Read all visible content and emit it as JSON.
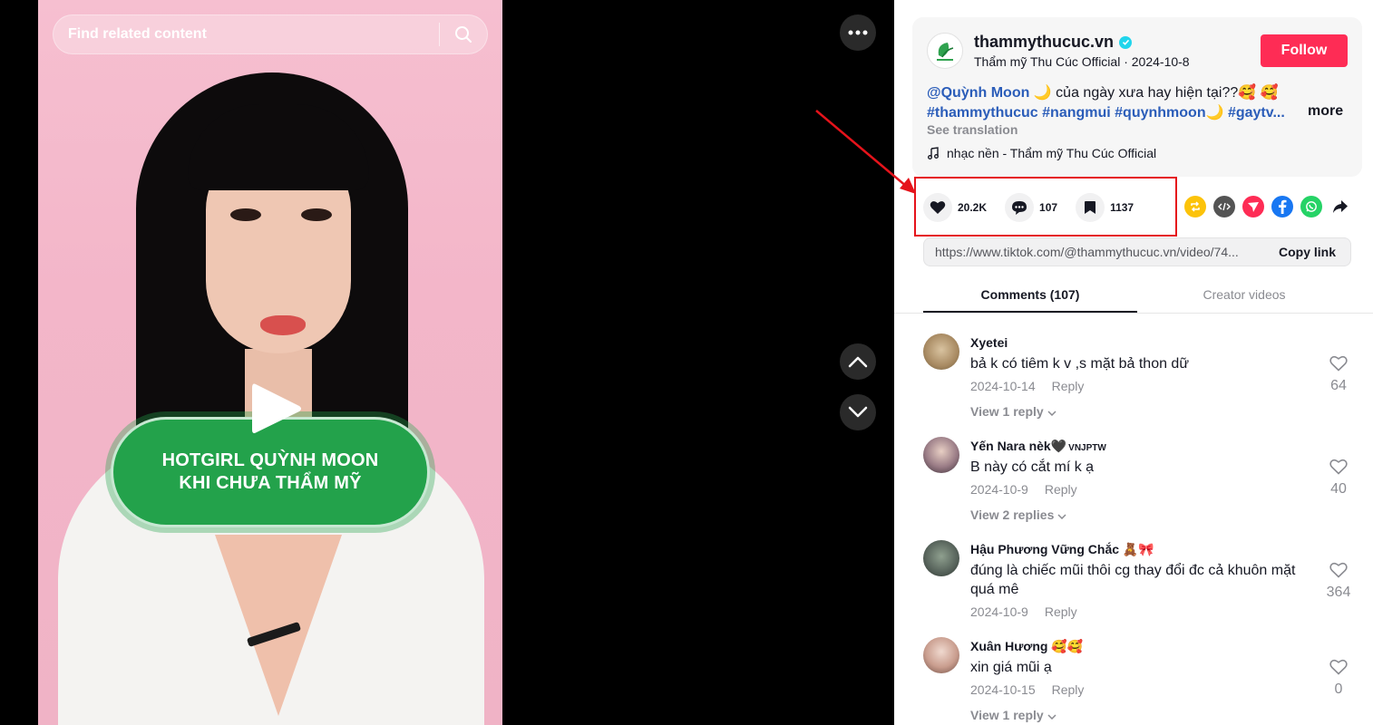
{
  "video": {
    "search_placeholder": "Find related content",
    "promo_line1": "HOTGIRL QUỲNH MOON",
    "promo_line2": "KHI CHƯA THẨM MỸ"
  },
  "post": {
    "username": "thammythucuc.vn",
    "display_name": "Thẩm mỹ Thu Cúc Official",
    "date": "2024-10-8",
    "follow_label": "Follow",
    "caption_mention": "@Quỳnh Moon",
    "caption_text1": " 🌙 của ngày xưa hay hiện tại??🥰 🥰",
    "caption_tags": "#thammythucuc #nangmui #quynhmoon🌙 #gaytv...",
    "more_label": "more",
    "see_translation": "See translation",
    "music": "nhạc nền - Thẩm mỹ Thu Cúc Official"
  },
  "stats": {
    "likes": "20.2K",
    "comments": "107",
    "saves": "1137"
  },
  "share": {
    "url": "https://www.tiktok.com/@thammythucuc.vn/video/74...",
    "copy_label": "Copy link",
    "icons": [
      "repost-icon",
      "embed-icon",
      "send-icon",
      "facebook-icon",
      "whatsapp-icon",
      "share-arrow-icon"
    ]
  },
  "tabs": [
    {
      "label": "Comments (107)"
    },
    {
      "label": "Creator videos"
    }
  ],
  "comments": [
    {
      "name": "Xyetei",
      "badge": "",
      "text": "bả k có tiêm k v ,s mặt bả thon dữ",
      "date": "2024-10-14",
      "reply": "Reply",
      "likes": "64",
      "view": "View 1 reply",
      "avatar_color": "#b99d74"
    },
    {
      "name": "Yến Nara nèk🖤",
      "badge": "VNJPTW",
      "text": "B này có cắt mí k ạ",
      "date": "2024-10-9",
      "reply": "Reply",
      "likes": "40",
      "view": "View 2 replies",
      "avatar_color": "#6b5a66"
    },
    {
      "name": "Hậu Phương Vững Chắc 🧸🎀",
      "badge": "",
      "text": "đúng là chiếc mũi thôi cg thay đổi đc cả khuôn mặt quá mê",
      "date": "2024-10-9",
      "reply": "Reply",
      "likes": "364",
      "view": "",
      "avatar_color": "#55625a"
    },
    {
      "name": "Xuân Hương 🥰🥰",
      "badge": "",
      "text": "xin giá mũi ạ",
      "date": "2024-10-15",
      "reply": "Reply",
      "likes": "0",
      "view": "View 1 reply",
      "avatar_color": "#c9a497"
    }
  ]
}
